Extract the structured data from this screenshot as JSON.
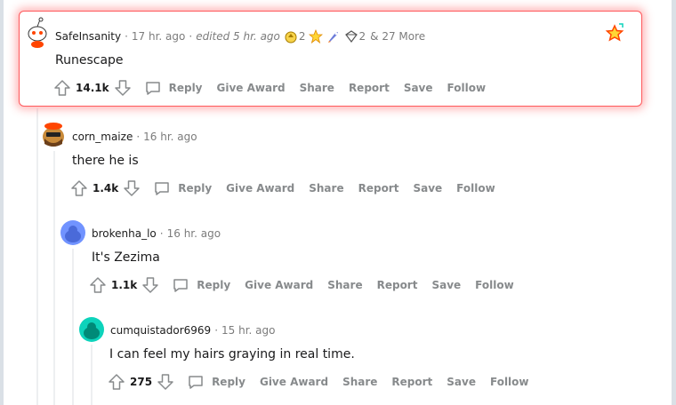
{
  "comments": [
    {
      "author": "SafeInsanity",
      "time": "17 hr. ago",
      "edited": "edited 5 hr. ago",
      "award_count_1": "2",
      "award_count_2": "2",
      "more_awards": "& 27 More",
      "body": "Runescape",
      "score": "14.1k",
      "avatar_color": "#ffffff"
    },
    {
      "author": "corn_maize",
      "time": "16 hr. ago",
      "body": "there he is",
      "score": "1.4k",
      "avatar_color": "#ffb000"
    },
    {
      "author": "brokenha_lo",
      "time": "16 hr. ago",
      "body": "It's Zezima",
      "score": "1.1k",
      "avatar_color": "#7193ff"
    },
    {
      "author": "cumquistador6969",
      "time": "15 hr. ago",
      "body": "I can feel my hairs graying in real time.",
      "score": "275",
      "avatar_color": "#0dd3bb"
    }
  ],
  "actions": {
    "reply": "Reply",
    "give_award": "Give Award",
    "share": "Share",
    "report": "Report",
    "save": "Save",
    "follow": "Follow"
  },
  "colors": {
    "highlight_border": "#ff585b",
    "meta_gray": "#7c7c7c",
    "action_gray": "#878a8c",
    "thread_line": "#edeff1"
  },
  "icons": [
    "upvote-icon",
    "downvote-icon",
    "reply-icon",
    "award-icon",
    "mod-shield-icon"
  ]
}
